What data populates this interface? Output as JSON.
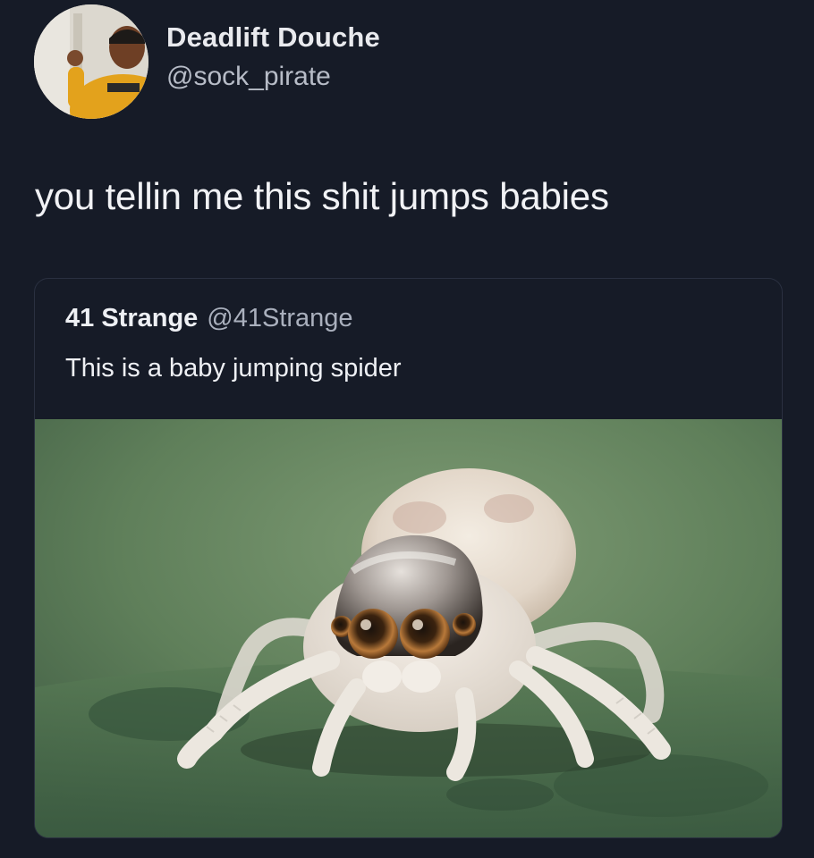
{
  "author": {
    "display_name": "Deadlift Douche",
    "handle": "@sock_pirate"
  },
  "tweet": {
    "text": "you tellin me this shit jumps babies"
  },
  "quoted_tweet": {
    "display_name": "41 Strange",
    "handle": "@41Strange",
    "text": "This is a baby jumping spider"
  },
  "colors": {
    "background": "#161b27",
    "text_primary": "#f1f2f5",
    "text_secondary": "#b7bcc7",
    "card_border": "#2a3040"
  }
}
